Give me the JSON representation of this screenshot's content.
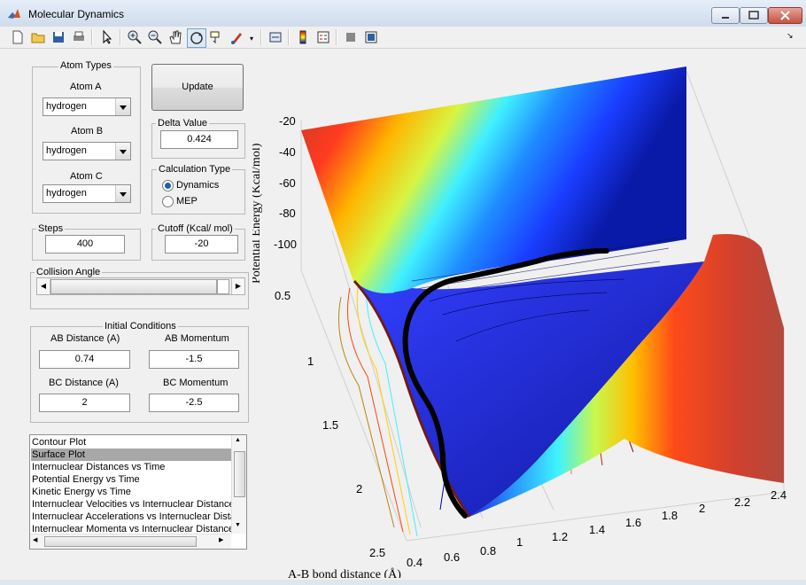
{
  "window": {
    "title": "Molecular Dynamics"
  },
  "toolbar": {
    "icons": [
      "new-file-icon",
      "open-file-icon",
      "save-icon",
      "print-icon",
      "pointer-icon",
      "zoom-in-icon",
      "zoom-out-icon",
      "pan-icon",
      "rotate-icon",
      "data-cursor-icon",
      "brush-icon",
      "link-icon",
      "colorbar-icon",
      "legend-icon",
      "hide-plot-tools-icon",
      "show-plot-tools-icon"
    ]
  },
  "atom_types": {
    "label": "Atom Types",
    "atom_a_label": "Atom A",
    "atom_a_value": "hydrogen",
    "atom_b_label": "Atom B",
    "atom_b_value": "hydrogen",
    "atom_c_label": "Atom C",
    "atom_c_value": "hydrogen"
  },
  "update_label": "Update",
  "delta": {
    "label": "Delta Value",
    "value": "0.424"
  },
  "calc_type": {
    "label": "Calculation Type",
    "options": [
      "Dynamics",
      "MEP"
    ],
    "selected": "Dynamics"
  },
  "steps": {
    "label": "Steps",
    "value": "400"
  },
  "cutoff": {
    "label": "Cutoff (Kcal/ mol)",
    "value": "-20"
  },
  "collision": {
    "label": "Collision Angle",
    "slider_fraction": 0.96
  },
  "initial": {
    "label": "Initial Conditions",
    "ab_distance_label": "AB Distance (A)",
    "ab_distance_value": "0.74",
    "ab_momentum_label": "AB Momentum",
    "ab_momentum_value": "-1.5",
    "bc_distance_label": "BC Distance (A)",
    "bc_distance_value": "2",
    "bc_momentum_label": "BC Momentum",
    "bc_momentum_value": "-2.5"
  },
  "plot_list": {
    "items": [
      "Contour Plot",
      "Surface Plot",
      "Internuclear Distances vs Time",
      "Potential Energy vs Time",
      "Kinetic Energy vs Time",
      "Internuclear Velocities vs Internuclear Distance",
      "Internuclear Accelerations vs Internuclear Distance",
      "Internuclear Momenta vs Internuclear Distance"
    ],
    "selected": "Surface Plot"
  },
  "chart_data": {
    "type": "surface",
    "zlabel": "Potential Energy (Kcal/mol)",
    "xlabel": "A-B bond distance (Å)",
    "z_ticks": [
      "-20",
      "-40",
      "-60",
      "-80",
      "-100"
    ],
    "y_ticks": [
      "0.5",
      "1",
      "1.5",
      "2",
      "2.5"
    ],
    "x_ticks": [
      "0.4",
      "0.6",
      "0.8",
      "1",
      "1.2",
      "1.4",
      "1.6",
      "1.8",
      "2",
      "2.2",
      "2.4"
    ],
    "colormap": "jet",
    "trajectory_color": "#000000"
  }
}
